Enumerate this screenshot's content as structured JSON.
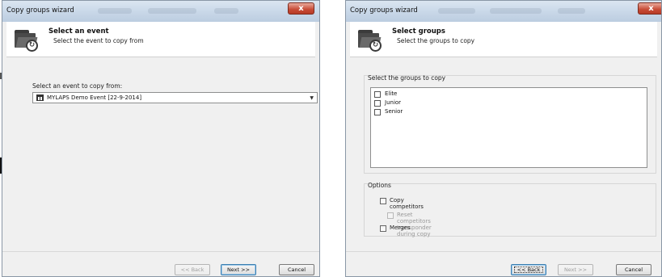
{
  "left_window": {
    "title": "Copy groups wizard",
    "close_glyph": "x",
    "header_title": "Select an event",
    "header_subtitle": "Select the event to copy from",
    "prompt_label": "Select an event to copy from:",
    "event_select_value": "MYLAPS Demo Event [22-9-2014]",
    "buttons": {
      "back": "<< Back",
      "next": "Next >>",
      "cancel": "Cancel"
    }
  },
  "right_window": {
    "title": "Copy groups wizard",
    "close_glyph": "x",
    "header_title": "Select groups",
    "header_subtitle": "Select the groups to copy",
    "groups_label": "Select the groups to copy",
    "groups": [
      {
        "label": "Elite",
        "checked": false
      },
      {
        "label": "Junior",
        "checked": false
      },
      {
        "label": "Senior",
        "checked": false
      }
    ],
    "options_label": "Options",
    "options": {
      "copy_competitors": "Copy competitors",
      "reset_transponder": "Reset competitors transponder during copy",
      "merges": "Merges"
    },
    "buttons": {
      "back": "<< Back",
      "next": "Next >>",
      "cancel": "Cancel"
    }
  },
  "icons": {
    "header_icon": "folder-copy-icon",
    "calendar_icon": "calendar-icon",
    "dropdown_icon": "chevron-down-icon",
    "close_icon": "close-icon"
  },
  "colors": {
    "title_bar": "#c8d7e8",
    "close_button": "#c74a35",
    "dialog_background": "#f0f0f0",
    "header_background": "#ffffff"
  }
}
